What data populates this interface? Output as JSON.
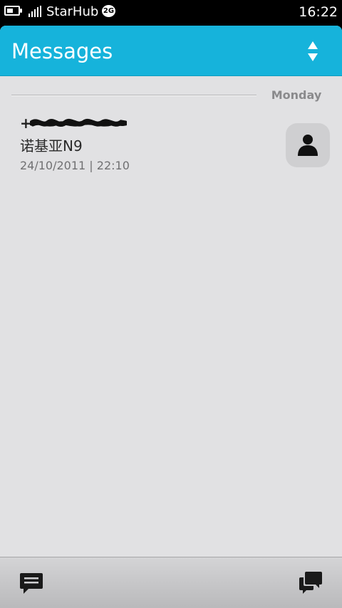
{
  "status_bar": {
    "operator": "StarHub",
    "network": "2G",
    "time": "16:22"
  },
  "header": {
    "title": "Messages",
    "sort_icon": "sort-arrows-icon"
  },
  "sections": [
    {
      "label": "Monday",
      "items": [
        {
          "sender_prefix": "+",
          "preview": "诺基亚N9",
          "timestamp": "24/10/2011 | 22:10",
          "avatar_icon": "person-icon"
        }
      ]
    }
  ],
  "toolbar": {
    "left_icon": "new-message-icon",
    "right_icon": "conversations-icon"
  },
  "colors": {
    "accent": "#16b3db",
    "background": "#e1e1e3"
  }
}
